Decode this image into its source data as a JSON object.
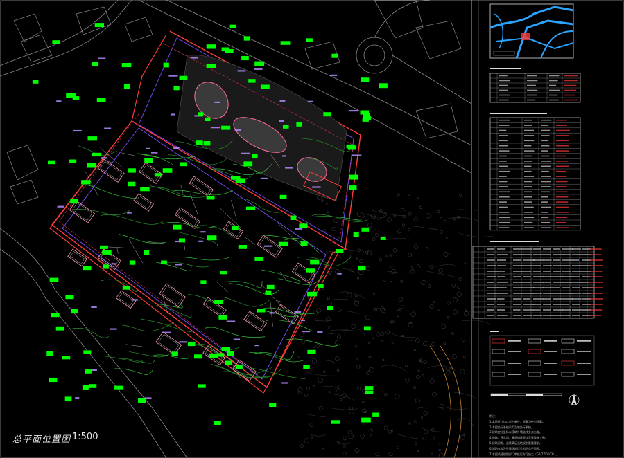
{
  "drawing": {
    "title": "总平面位置图",
    "scale": "1:500"
  },
  "notes": {
    "heading": "附注：",
    "lines": [
      "1.本图尺寸均以米为单位，标高为绝对标高。",
      "2.本图坐标系统采用当地坐标系统。",
      "3.建筑定位坐标以建筑外墙轴线交点为准。",
      "4.道路、停车场、硬质铺装等详见景观施工图。",
      "5.建筑间距、退线满足当地规划管理要求。",
      "6.消防车道及登高场地详见消防总平面图。",
      "7.本图须经规划部门审批后方可施工（GB/T 50103）。"
    ]
  },
  "colors": {
    "background": "#000000",
    "site_boundary": "#ff3b3b",
    "dimension_labels": "#00ff00",
    "annotations": "#b48cff",
    "roads": "#9a9a9a",
    "buildings": "#ff9db3",
    "contours": "#3cb43c",
    "table_lines": "#ffffff"
  }
}
